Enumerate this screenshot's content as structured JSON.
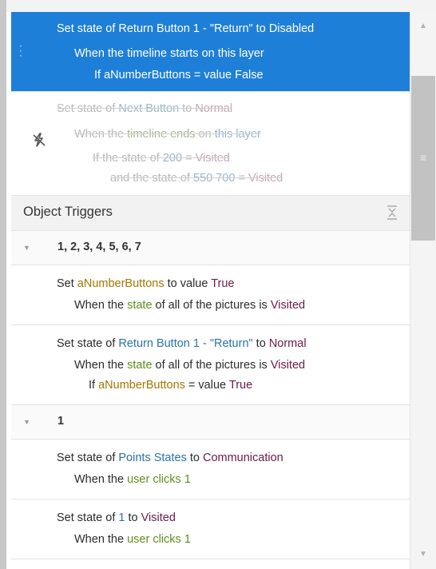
{
  "layer_triggers": [
    {
      "selected": true,
      "lines": [
        [
          "Set state of ",
          "Return Button 1 - \"Return\"",
          " to ",
          "Disabled"
        ],
        [
          "When the timeline starts on this layer"
        ],
        [
          "If aNumberButtons = value False"
        ]
      ]
    },
    {
      "disabled": true,
      "lines": [
        [
          "Set state of ",
          "Next Button",
          " to ",
          "Normal"
        ],
        [
          "When the ",
          "timeline ends",
          " on ",
          "this layer"
        ],
        [
          "If the state of ",
          "200",
          " = ",
          "Visited"
        ],
        [
          "and the state of ",
          "550 700",
          " = ",
          "Visited"
        ]
      ]
    }
  ],
  "object_triggers": {
    "title": "Object Triggers",
    "groups": [
      {
        "title": "1, 2, 3, 4, 5, 6, 7",
        "trigger_1": {
          "l1": [
            "Set ",
            "aNumberButtons",
            " to value ",
            "True"
          ],
          "l2": [
            "When the ",
            "state",
            " of all of the pictures is ",
            "Visited"
          ]
        },
        "trigger_2": {
          "l1": [
            "Set state of ",
            "Return Button 1 - \"Return\"",
            " to ",
            "Normal"
          ],
          "l2": [
            "When the ",
            "state",
            " of all of the pictures is ",
            "Visited"
          ],
          "l3": [
            "If ",
            "aNumberButtons",
            " = value ",
            "True"
          ]
        }
      },
      {
        "title": "1",
        "trigger_1": {
          "l1": [
            "Set state of ",
            "Points States",
            " to ",
            "Communication"
          ],
          "l2": [
            "When the ",
            "user clicks",
            " ",
            "1"
          ]
        },
        "trigger_2": {
          "l1": [
            "Set state of ",
            "1",
            " to ",
            "Visited"
          ],
          "l2": [
            "When the ",
            "user clicks",
            " ",
            "1"
          ]
        }
      }
    ]
  },
  "scrollbar": {
    "up_icon": "▲",
    "down_icon": "▼",
    "grip_icon": "≡"
  },
  "colors": {
    "selected_bg": "#1e7fd8",
    "object": "#2a73a8",
    "value": "#6b1a4a",
    "event": "#5e8f1c",
    "variable": "#a07800"
  }
}
